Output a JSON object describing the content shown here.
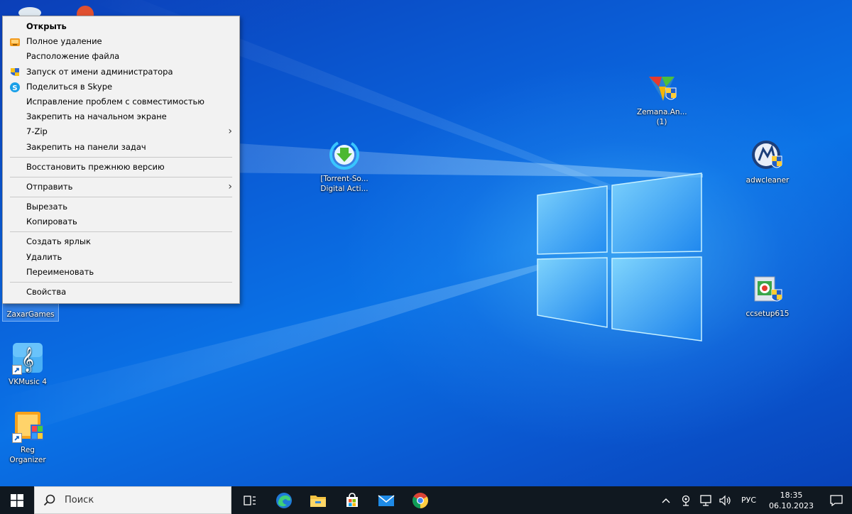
{
  "context_menu": {
    "items": [
      {
        "label": "Открыть",
        "bold": true
      },
      {
        "label": "Полное удаление",
        "icon": "uninstall-icon"
      },
      {
        "label": "Расположение файла"
      },
      {
        "label": "Запуск от имени администратора",
        "icon": "admin-shield-icon"
      },
      {
        "label": "Поделиться в Skype",
        "icon": "skype-icon"
      },
      {
        "label": "Исправление проблем с совместимостью"
      },
      {
        "label": "Закрепить на начальном экране"
      },
      {
        "label": "7-Zip",
        "submenu": true
      },
      {
        "label": "Закрепить на панели задач"
      },
      {
        "label": "Восстановить прежнюю версию"
      },
      {
        "label": "Отправить",
        "submenu": true
      },
      {
        "label": "Вырезать"
      },
      {
        "label": "Копировать"
      },
      {
        "label": "Создать ярлык"
      },
      {
        "label": "Удалить"
      },
      {
        "label": "Переименовать"
      },
      {
        "label": "Свойства"
      }
    ]
  },
  "desktop_icons": {
    "zaxargames": "ZaxarGames",
    "vkmusic": "VKMusic 4",
    "reg_organizer": "Reg Organizer",
    "torrent": "[Torrent-So... Digital Acti...",
    "zemana": "Zemana.An... (1)",
    "adwcleaner": "adwcleaner",
    "ccsetup": "ccsetup615"
  },
  "taskbar": {
    "search_placeholder": "Поиск",
    "language": "РУС",
    "time": "18:35",
    "date": "06.10.2023"
  },
  "colors": {
    "wallpaper": "#0a5fd8",
    "taskbar": "#101820",
    "menu_bg": "#f2f2f2"
  }
}
